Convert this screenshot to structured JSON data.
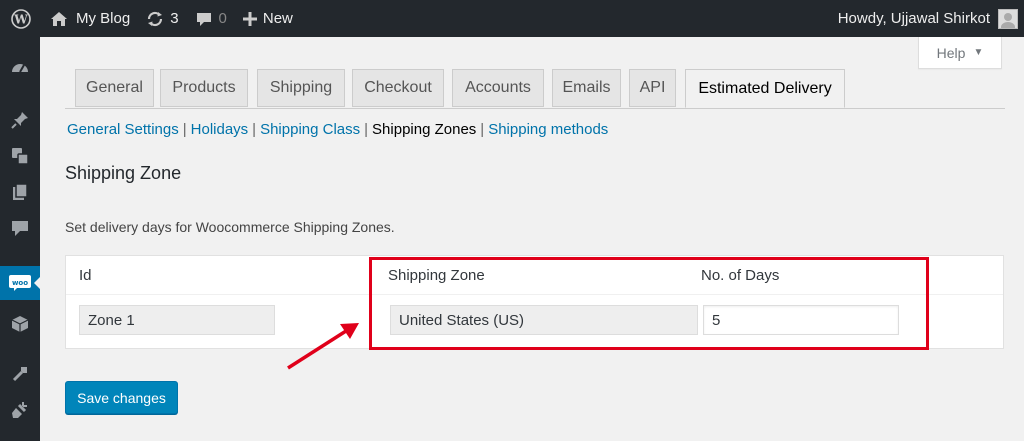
{
  "adminbar": {
    "site_name": "My Blog",
    "updates_count": "3",
    "comments_count": "0",
    "new_label": "New",
    "greeting": "Howdy, Ujjawal Shirkot"
  },
  "help": {
    "label": "Help"
  },
  "tabs": [
    {
      "label": "General"
    },
    {
      "label": "Products"
    },
    {
      "label": "Shipping"
    },
    {
      "label": "Checkout"
    },
    {
      "label": "Accounts"
    },
    {
      "label": "Emails"
    },
    {
      "label": "API"
    },
    {
      "label": "Estimated Delivery",
      "active": true
    }
  ],
  "subnav": {
    "general_settings": "General Settings",
    "holidays": "Holidays",
    "shipping_class": "Shipping Class",
    "shipping_zones": "Shipping Zones",
    "shipping_methods": "Shipping methods",
    "separator": "|"
  },
  "page": {
    "title": "Shipping Zone",
    "description": "Set delivery days for Woocommerce Shipping Zones."
  },
  "table": {
    "headers": {
      "id": "Id",
      "zone": "Shipping Zone",
      "days": "No. of Days"
    },
    "rows": [
      {
        "id": "Zone 1",
        "zone": "United States (US)",
        "days": "5"
      }
    ]
  },
  "actions": {
    "save_label": "Save changes"
  },
  "colors": {
    "adminbar_bg": "#23282d",
    "link": "#0073aa",
    "primary_button": "#0085ba",
    "annotation_red": "#e0001a"
  },
  "icons": {
    "adminbar": [
      "wordpress-logo-icon",
      "home-icon",
      "updates-icon",
      "comment-icon",
      "plus-icon"
    ],
    "sidebar": [
      "dashboard-icon",
      "pin-icon",
      "media-icon",
      "pages-icon",
      "comments-icon",
      "woocommerce-icon",
      "products-icon",
      "appearance-icon",
      "plugins-icon"
    ]
  }
}
